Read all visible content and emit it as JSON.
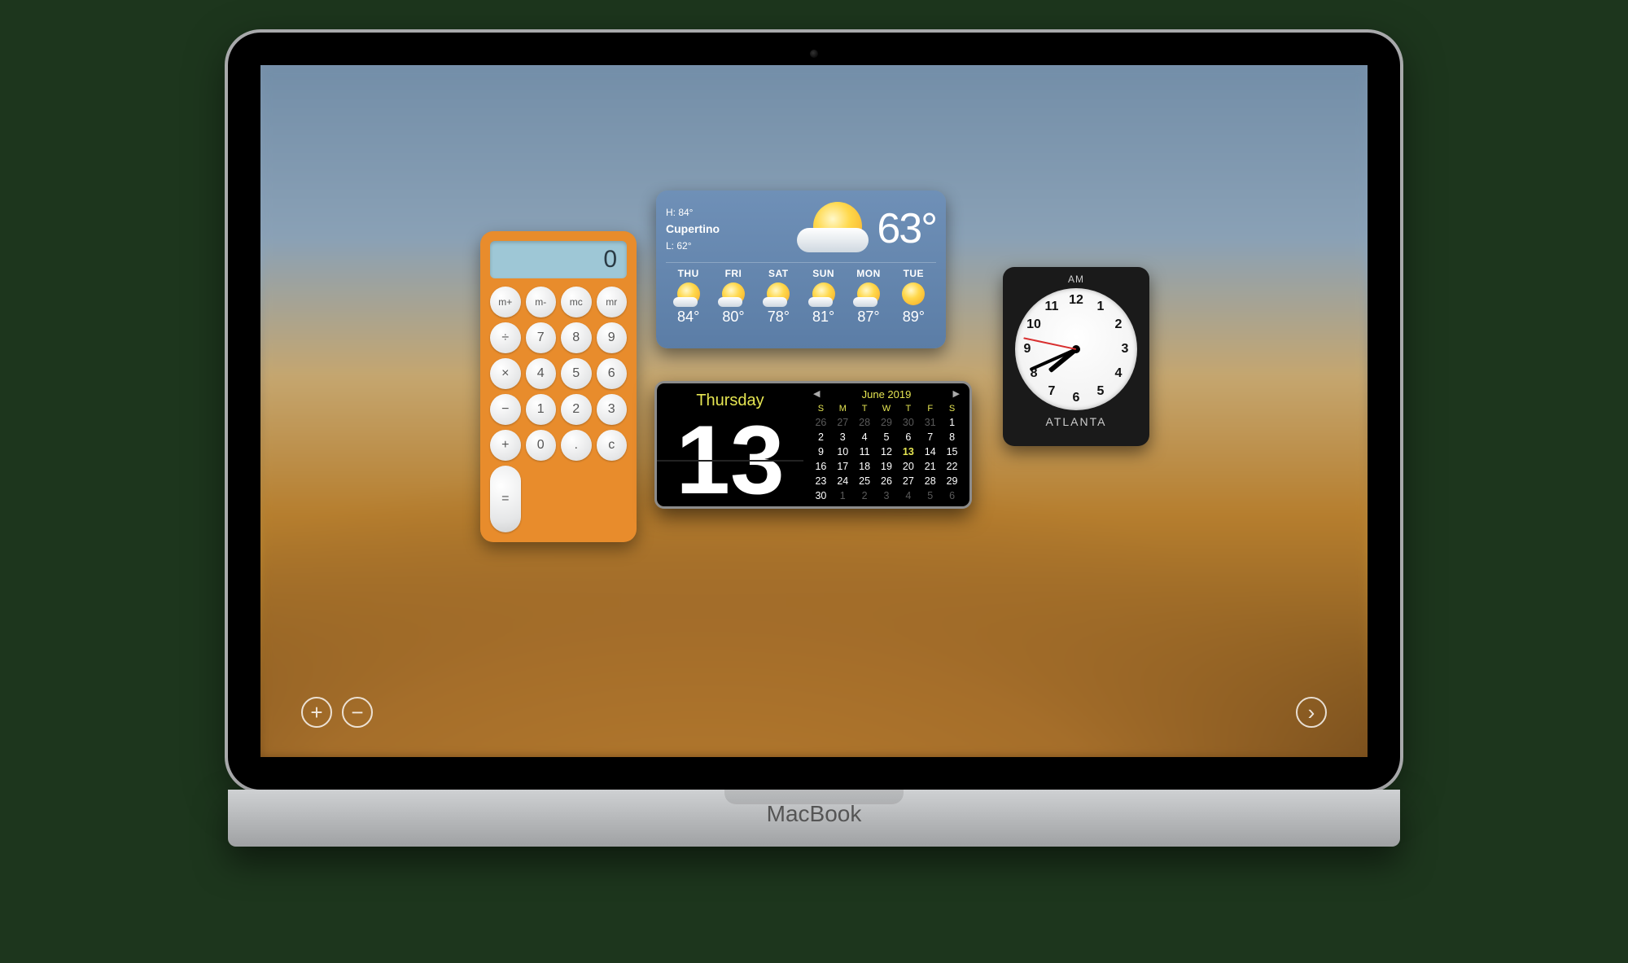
{
  "device": {
    "brand": "MacBook"
  },
  "dashboard": {
    "plus_label": "+",
    "minus_label": "−",
    "next_label": "›"
  },
  "calculator": {
    "display": "0",
    "keys": [
      "m+",
      "m-",
      "mc",
      "mr",
      "÷",
      "7",
      "8",
      "9",
      "×",
      "4",
      "5",
      "6",
      "−",
      "1",
      "2",
      "3",
      "+",
      "0",
      ".",
      "c",
      "="
    ]
  },
  "weather": {
    "high_label": "H: 84°",
    "city": "Cupertino",
    "low_label": "L: 62°",
    "current_temp": "63°",
    "days": [
      {
        "name": "THU",
        "temp": "84°",
        "cloud": true
      },
      {
        "name": "FRI",
        "temp": "80°",
        "cloud": true
      },
      {
        "name": "SAT",
        "temp": "78°",
        "cloud": true
      },
      {
        "name": "SUN",
        "temp": "81°",
        "cloud": true
      },
      {
        "name": "MON",
        "temp": "87°",
        "cloud": true
      },
      {
        "name": "TUE",
        "temp": "89°",
        "cloud": false
      }
    ]
  },
  "calendar": {
    "day_of_week": "Thursday",
    "day_big": "13",
    "month_title": "June 2019",
    "dow_short": [
      "S",
      "M",
      "T",
      "W",
      "T",
      "F",
      "S"
    ],
    "rows": [
      [
        {
          "n": "26",
          "d": true
        },
        {
          "n": "27",
          "d": true
        },
        {
          "n": "28",
          "d": true
        },
        {
          "n": "29",
          "d": true
        },
        {
          "n": "30",
          "d": true
        },
        {
          "n": "31",
          "d": true
        },
        {
          "n": "1"
        }
      ],
      [
        {
          "n": "2"
        },
        {
          "n": "3"
        },
        {
          "n": "4"
        },
        {
          "n": "5"
        },
        {
          "n": "6"
        },
        {
          "n": "7"
        },
        {
          "n": "8"
        }
      ],
      [
        {
          "n": "9"
        },
        {
          "n": "10"
        },
        {
          "n": "11"
        },
        {
          "n": "12"
        },
        {
          "n": "13",
          "t": true
        },
        {
          "n": "14"
        },
        {
          "n": "15"
        }
      ],
      [
        {
          "n": "16"
        },
        {
          "n": "17"
        },
        {
          "n": "18"
        },
        {
          "n": "19"
        },
        {
          "n": "20"
        },
        {
          "n": "21"
        },
        {
          "n": "22"
        }
      ],
      [
        {
          "n": "23"
        },
        {
          "n": "24"
        },
        {
          "n": "25"
        },
        {
          "n": "26"
        },
        {
          "n": "27"
        },
        {
          "n": "28"
        },
        {
          "n": "29"
        }
      ],
      [
        {
          "n": "30"
        },
        {
          "n": "1",
          "d": true
        },
        {
          "n": "2",
          "d": true
        },
        {
          "n": "3",
          "d": true
        },
        {
          "n": "4",
          "d": true
        },
        {
          "n": "5",
          "d": true
        },
        {
          "n": "6",
          "d": true
        }
      ]
    ]
  },
  "clock": {
    "ampm": "AM",
    "timezone": "ATLANTA",
    "hour": 7,
    "minute": 41,
    "second": 47,
    "numbers": [
      "12",
      "1",
      "2",
      "3",
      "4",
      "5",
      "6",
      "7",
      "8",
      "9",
      "10",
      "11"
    ]
  }
}
